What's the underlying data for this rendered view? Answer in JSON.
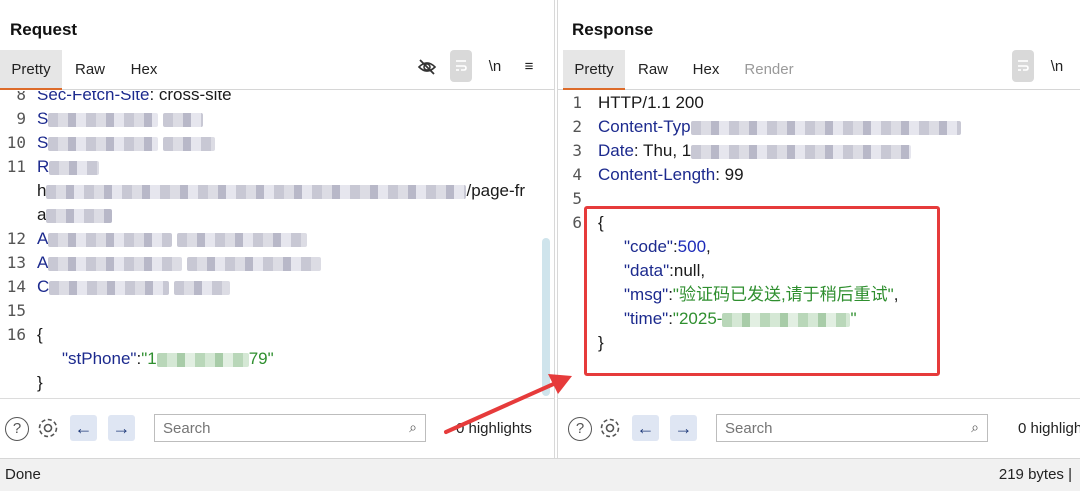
{
  "request": {
    "title": "Request",
    "tabs": [
      "Pretty",
      "Raw",
      "Hex"
    ],
    "active_tab": "Pretty",
    "tools": {
      "newline": "\\n",
      "menu": "≡"
    },
    "lines": [
      {
        "num": "8",
        "key": "Sec-Fetch-Site",
        "rest": ": cross-site"
      },
      {
        "num": "9",
        "key": "S",
        "rest": ""
      },
      {
        "num": "10",
        "key": "S",
        "rest": ""
      },
      {
        "num": "11",
        "key": "R",
        "rest": ""
      },
      {
        "num": "",
        "key": "",
        "rest": "h",
        "tail": "/page-fr"
      },
      {
        "num": "",
        "key": "",
        "rest": "a"
      },
      {
        "num": "12",
        "key": "A",
        "rest": ""
      },
      {
        "num": "13",
        "key": "A",
        "rest": ""
      },
      {
        "num": "14",
        "key": "C",
        "rest": ""
      },
      {
        "num": "15",
        "key": "",
        "rest": ""
      },
      {
        "num": "16",
        "key": "",
        "rest": "{"
      }
    ],
    "body": {
      "open": "{",
      "key": "\"stPhone\"",
      "colon": ":",
      "value_start": "\"1",
      "value_end": "79\"",
      "close": "}"
    },
    "search_placeholder": "Search",
    "highlights": "0 highlights"
  },
  "response": {
    "title": "Response",
    "tabs": [
      "Pretty",
      "Raw",
      "Hex",
      "Render"
    ],
    "active_tab": "Pretty",
    "tools": {
      "newline": "\\n"
    },
    "lines": [
      {
        "num": "1",
        "text": "HTTP/1.1 200"
      },
      {
        "num": "2",
        "key": "Content-Typ"
      },
      {
        "num": "3",
        "key": "Date",
        "rest": ": Thu, 1"
      },
      {
        "num": "4",
        "key": "Content-Length",
        "rest": ": 99"
      },
      {
        "num": "5",
        "text": ""
      },
      {
        "num": "6",
        "text": "{"
      }
    ],
    "json": {
      "code_key": "\"code\"",
      "code_val": "500",
      "data_key": "\"data\"",
      "data_val": "null",
      "msg_key": "\"msg\"",
      "msg_val": "\"验证码已发送,请于稍后重试\"",
      "time_key": "\"time\"",
      "time_val_start": "\"2025-",
      "time_val_end": "\"",
      "close": "}"
    },
    "search_placeholder": "Search",
    "highlights": "0 highligh"
  },
  "status": {
    "left": "Done",
    "right": "219 bytes |"
  },
  "colors": {
    "accent_tab": "#dd6b2a",
    "annotation": "#e63b3b"
  },
  "icons": [
    "eye-slash-icon",
    "wrap-icon",
    "help-icon",
    "gear-icon",
    "arrow-left-icon",
    "arrow-right-icon",
    "magnifier-icon"
  ]
}
